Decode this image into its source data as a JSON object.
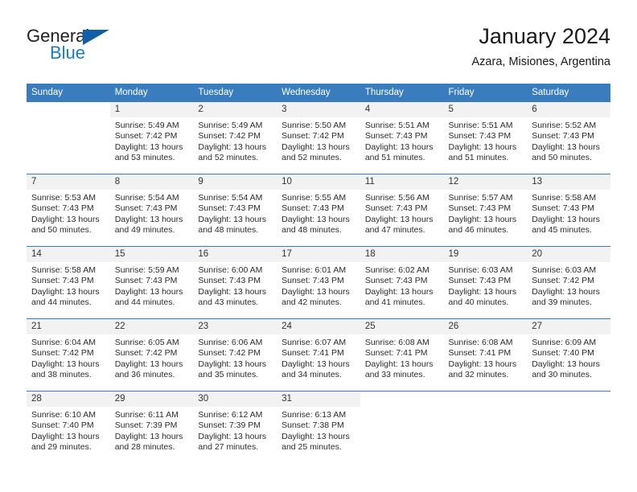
{
  "brand": {
    "name_top": "General",
    "name_bottom": "Blue",
    "accent_color": "#1a7dc4",
    "triangle_color": "#1060a8"
  },
  "header": {
    "title": "January 2024",
    "subtitle": "Azara, Misiones, Argentina"
  },
  "calendar": {
    "header_bg": "#3a7dbf",
    "daynum_bg": "#f2f2f2",
    "weekday_headers": [
      "Sunday",
      "Monday",
      "Tuesday",
      "Wednesday",
      "Thursday",
      "Friday",
      "Saturday"
    ],
    "weeks": [
      [
        {
          "day": "",
          "sunrise": "",
          "sunset": "",
          "daylight_line1": "",
          "daylight_line2": "",
          "empty": true
        },
        {
          "day": "1",
          "sunrise": "Sunrise: 5:49 AM",
          "sunset": "Sunset: 7:42 PM",
          "daylight_line1": "Daylight: 13 hours",
          "daylight_line2": "and 53 minutes."
        },
        {
          "day": "2",
          "sunrise": "Sunrise: 5:49 AM",
          "sunset": "Sunset: 7:42 PM",
          "daylight_line1": "Daylight: 13 hours",
          "daylight_line2": "and 52 minutes."
        },
        {
          "day": "3",
          "sunrise": "Sunrise: 5:50 AM",
          "sunset": "Sunset: 7:42 PM",
          "daylight_line1": "Daylight: 13 hours",
          "daylight_line2": "and 52 minutes."
        },
        {
          "day": "4",
          "sunrise": "Sunrise: 5:51 AM",
          "sunset": "Sunset: 7:43 PM",
          "daylight_line1": "Daylight: 13 hours",
          "daylight_line2": "and 51 minutes."
        },
        {
          "day": "5",
          "sunrise": "Sunrise: 5:51 AM",
          "sunset": "Sunset: 7:43 PM",
          "daylight_line1": "Daylight: 13 hours",
          "daylight_line2": "and 51 minutes."
        },
        {
          "day": "6",
          "sunrise": "Sunrise: 5:52 AM",
          "sunset": "Sunset: 7:43 PM",
          "daylight_line1": "Daylight: 13 hours",
          "daylight_line2": "and 50 minutes."
        }
      ],
      [
        {
          "day": "7",
          "sunrise": "Sunrise: 5:53 AM",
          "sunset": "Sunset: 7:43 PM",
          "daylight_line1": "Daylight: 13 hours",
          "daylight_line2": "and 50 minutes."
        },
        {
          "day": "8",
          "sunrise": "Sunrise: 5:54 AM",
          "sunset": "Sunset: 7:43 PM",
          "daylight_line1": "Daylight: 13 hours",
          "daylight_line2": "and 49 minutes."
        },
        {
          "day": "9",
          "sunrise": "Sunrise: 5:54 AM",
          "sunset": "Sunset: 7:43 PM",
          "daylight_line1": "Daylight: 13 hours",
          "daylight_line2": "and 48 minutes."
        },
        {
          "day": "10",
          "sunrise": "Sunrise: 5:55 AM",
          "sunset": "Sunset: 7:43 PM",
          "daylight_line1": "Daylight: 13 hours",
          "daylight_line2": "and 48 minutes."
        },
        {
          "day": "11",
          "sunrise": "Sunrise: 5:56 AM",
          "sunset": "Sunset: 7:43 PM",
          "daylight_line1": "Daylight: 13 hours",
          "daylight_line2": "and 47 minutes."
        },
        {
          "day": "12",
          "sunrise": "Sunrise: 5:57 AM",
          "sunset": "Sunset: 7:43 PM",
          "daylight_line1": "Daylight: 13 hours",
          "daylight_line2": "and 46 minutes."
        },
        {
          "day": "13",
          "sunrise": "Sunrise: 5:58 AM",
          "sunset": "Sunset: 7:43 PM",
          "daylight_line1": "Daylight: 13 hours",
          "daylight_line2": "and 45 minutes."
        }
      ],
      [
        {
          "day": "14",
          "sunrise": "Sunrise: 5:58 AM",
          "sunset": "Sunset: 7:43 PM",
          "daylight_line1": "Daylight: 13 hours",
          "daylight_line2": "and 44 minutes."
        },
        {
          "day": "15",
          "sunrise": "Sunrise: 5:59 AM",
          "sunset": "Sunset: 7:43 PM",
          "daylight_line1": "Daylight: 13 hours",
          "daylight_line2": "and 44 minutes."
        },
        {
          "day": "16",
          "sunrise": "Sunrise: 6:00 AM",
          "sunset": "Sunset: 7:43 PM",
          "daylight_line1": "Daylight: 13 hours",
          "daylight_line2": "and 43 minutes."
        },
        {
          "day": "17",
          "sunrise": "Sunrise: 6:01 AM",
          "sunset": "Sunset: 7:43 PM",
          "daylight_line1": "Daylight: 13 hours",
          "daylight_line2": "and 42 minutes."
        },
        {
          "day": "18",
          "sunrise": "Sunrise: 6:02 AM",
          "sunset": "Sunset: 7:43 PM",
          "daylight_line1": "Daylight: 13 hours",
          "daylight_line2": "and 41 minutes."
        },
        {
          "day": "19",
          "sunrise": "Sunrise: 6:03 AM",
          "sunset": "Sunset: 7:43 PM",
          "daylight_line1": "Daylight: 13 hours",
          "daylight_line2": "and 40 minutes."
        },
        {
          "day": "20",
          "sunrise": "Sunrise: 6:03 AM",
          "sunset": "Sunset: 7:42 PM",
          "daylight_line1": "Daylight: 13 hours",
          "daylight_line2": "and 39 minutes."
        }
      ],
      [
        {
          "day": "21",
          "sunrise": "Sunrise: 6:04 AM",
          "sunset": "Sunset: 7:42 PM",
          "daylight_line1": "Daylight: 13 hours",
          "daylight_line2": "and 38 minutes."
        },
        {
          "day": "22",
          "sunrise": "Sunrise: 6:05 AM",
          "sunset": "Sunset: 7:42 PM",
          "daylight_line1": "Daylight: 13 hours",
          "daylight_line2": "and 36 minutes."
        },
        {
          "day": "23",
          "sunrise": "Sunrise: 6:06 AM",
          "sunset": "Sunset: 7:42 PM",
          "daylight_line1": "Daylight: 13 hours",
          "daylight_line2": "and 35 minutes."
        },
        {
          "day": "24",
          "sunrise": "Sunrise: 6:07 AM",
          "sunset": "Sunset: 7:41 PM",
          "daylight_line1": "Daylight: 13 hours",
          "daylight_line2": "and 34 minutes."
        },
        {
          "day": "25",
          "sunrise": "Sunrise: 6:08 AM",
          "sunset": "Sunset: 7:41 PM",
          "daylight_line1": "Daylight: 13 hours",
          "daylight_line2": "and 33 minutes."
        },
        {
          "day": "26",
          "sunrise": "Sunrise: 6:08 AM",
          "sunset": "Sunset: 7:41 PM",
          "daylight_line1": "Daylight: 13 hours",
          "daylight_line2": "and 32 minutes."
        },
        {
          "day": "27",
          "sunrise": "Sunrise: 6:09 AM",
          "sunset": "Sunset: 7:40 PM",
          "daylight_line1": "Daylight: 13 hours",
          "daylight_line2": "and 30 minutes."
        }
      ],
      [
        {
          "day": "28",
          "sunrise": "Sunrise: 6:10 AM",
          "sunset": "Sunset: 7:40 PM",
          "daylight_line1": "Daylight: 13 hours",
          "daylight_line2": "and 29 minutes."
        },
        {
          "day": "29",
          "sunrise": "Sunrise: 6:11 AM",
          "sunset": "Sunset: 7:39 PM",
          "daylight_line1": "Daylight: 13 hours",
          "daylight_line2": "and 28 minutes."
        },
        {
          "day": "30",
          "sunrise": "Sunrise: 6:12 AM",
          "sunset": "Sunset: 7:39 PM",
          "daylight_line1": "Daylight: 13 hours",
          "daylight_line2": "and 27 minutes."
        },
        {
          "day": "31",
          "sunrise": "Sunrise: 6:13 AM",
          "sunset": "Sunset: 7:38 PM",
          "daylight_line1": "Daylight: 13 hours",
          "daylight_line2": "and 25 minutes."
        },
        {
          "day": "",
          "sunrise": "",
          "sunset": "",
          "daylight_line1": "",
          "daylight_line2": "",
          "empty": true
        },
        {
          "day": "",
          "sunrise": "",
          "sunset": "",
          "daylight_line1": "",
          "daylight_line2": "",
          "empty": true
        },
        {
          "day": "",
          "sunrise": "",
          "sunset": "",
          "daylight_line1": "",
          "daylight_line2": "",
          "empty": true
        }
      ]
    ]
  }
}
